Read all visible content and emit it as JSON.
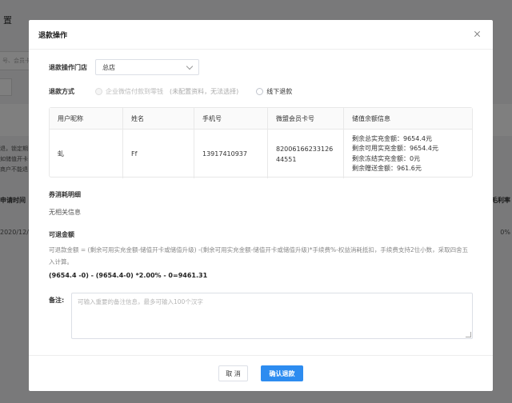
{
  "background": {
    "title": "置",
    "search_placeholder": "号、会员卡",
    "tip_lines": [
      "退，锁定期",
      "如储值开卡",
      "商户不能退"
    ],
    "col_left_header": "申请时间",
    "col_left_cell": "2020/12/0",
    "col_right_header": "毛利率",
    "col_right_cell": "0%"
  },
  "modal": {
    "title": "退款操作",
    "store_label": "退款操作门店",
    "store_value": "总店",
    "method_label": "退款方式",
    "method_option_1": "企业微信付款到零钱",
    "method_option_1_note": "(未配置资料，无法选择)",
    "method_option_2": "线下退款",
    "table": {
      "headers": [
        "用户昵称",
        "姓名",
        "手机号",
        "微盟会员卡号",
        "储值余额信息"
      ],
      "row": {
        "nickname": "虬",
        "name": "Ff",
        "phone": "13917410937",
        "card_no": "8200616623312644551",
        "balance_lines": [
          "剩余总实充金额：9654.4元",
          "剩余可用实充金额：9654.4元",
          "剩余冻结实充金额：0元",
          "剩余赠送金额：961.6元"
        ]
      }
    },
    "coupon_title": "券消耗明细",
    "coupon_empty": "无相关信息",
    "refundable_title": "可退金额",
    "formula": "可退款金额 = (剩余可用实充金额-储值开卡或储值升级) -(剩余可用实充金额-储值开卡或储值升级)*手续费%-权益消耗抵扣，手续费支持2位小数，采取四舍五入计算。",
    "calc": "(9654.4 -0) - (9654.4-0) *2.00% - 0=9461.31",
    "remark_label": "备注:",
    "remark_placeholder": "可输入重要的备注信息，最多可输入100个汉字",
    "cancel_label": "取 消",
    "confirm_label": "确认退款"
  },
  "colors": {
    "primary": "#2d8cf0",
    "overlay": "rgba(0,0,0,0.5)"
  }
}
